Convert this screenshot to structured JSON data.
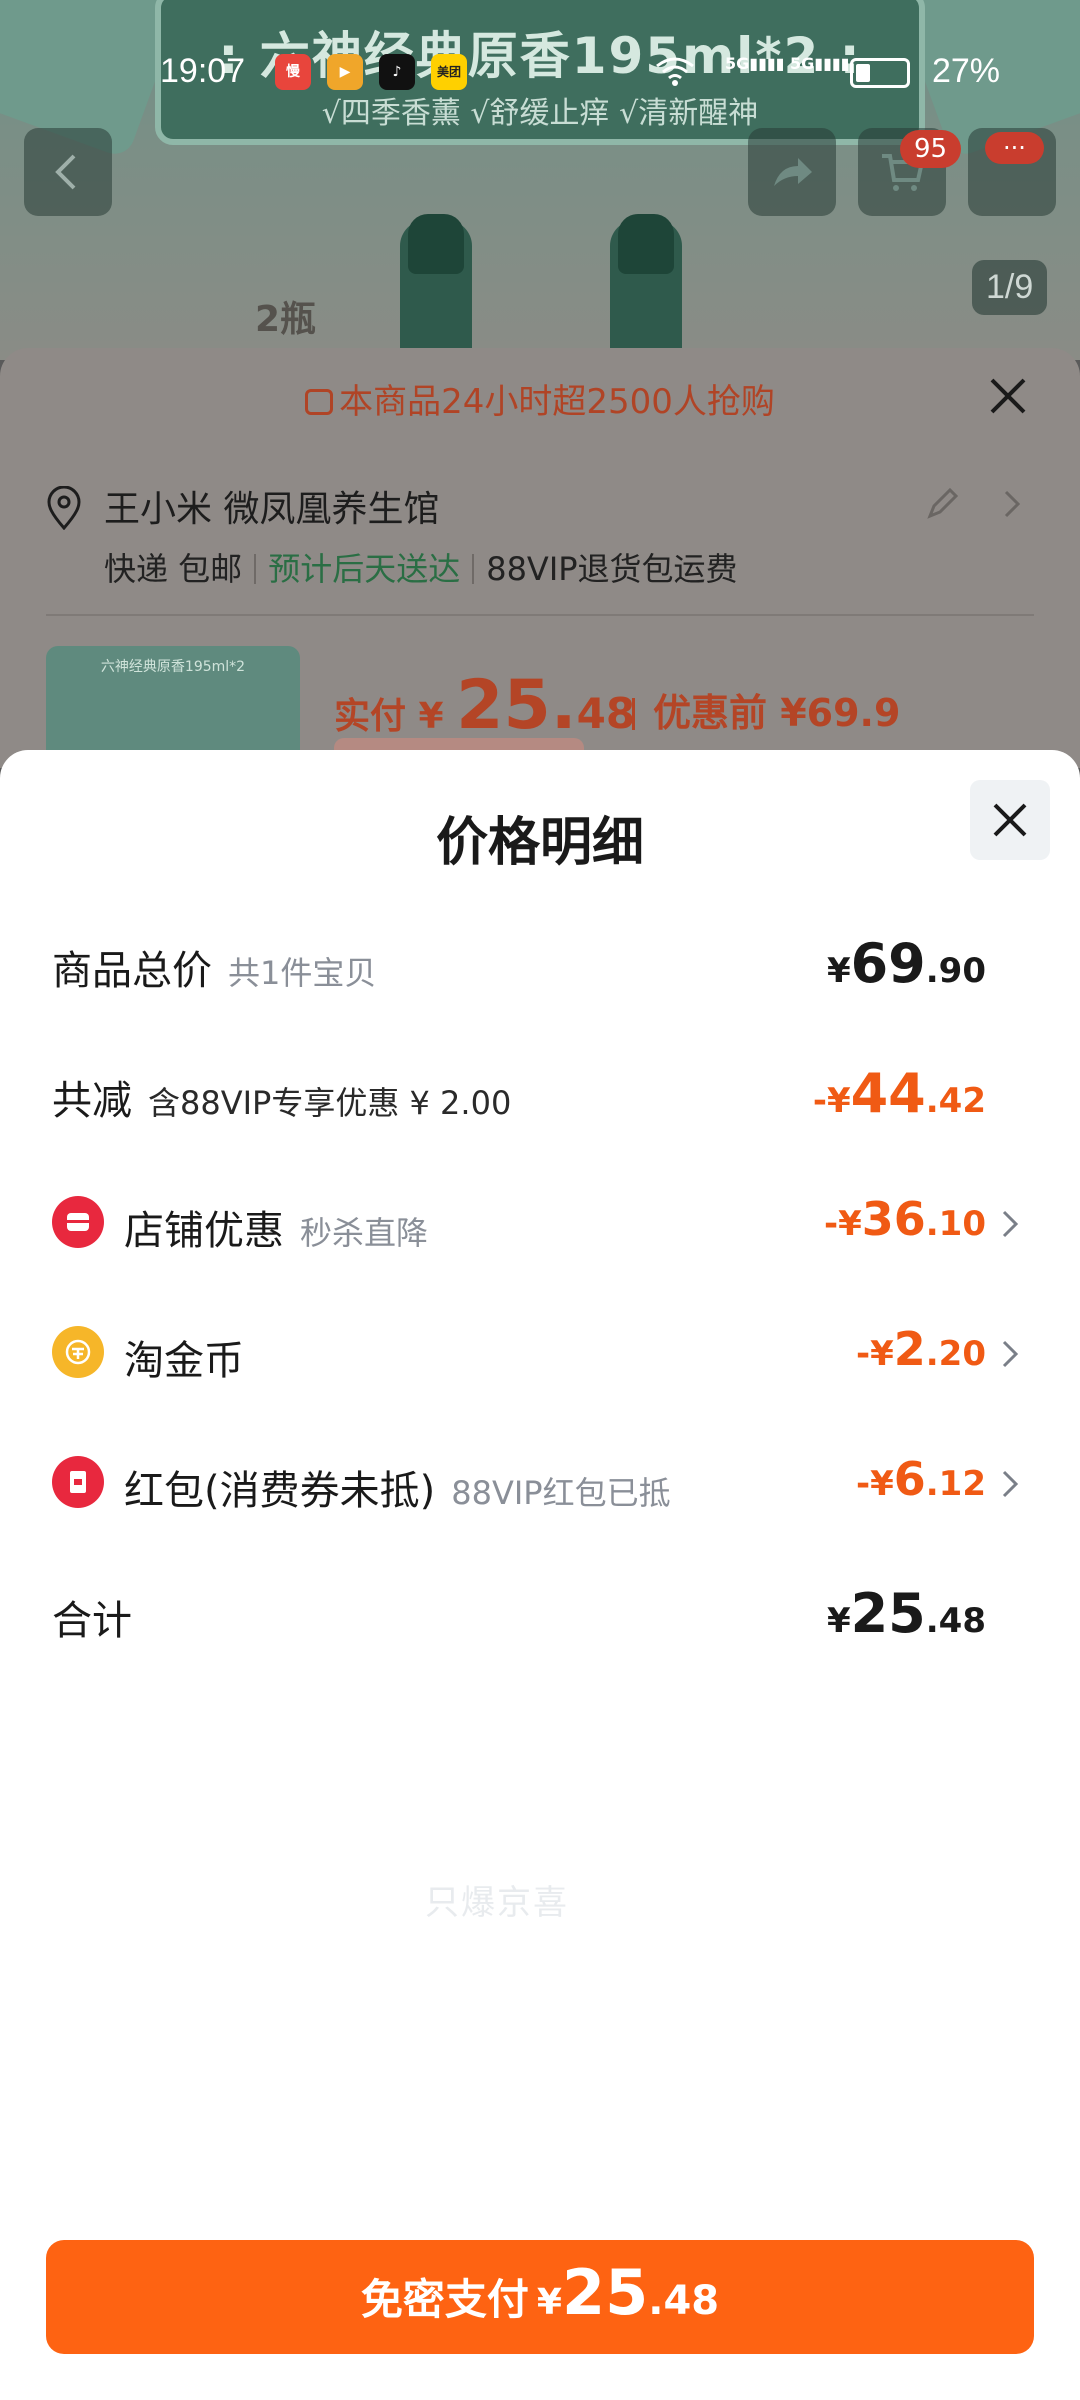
{
  "status_bar": {
    "time": "19:07",
    "battery": "27%",
    "apps": [
      "慢",
      "▶",
      "♪",
      "美团"
    ]
  },
  "background_page": {
    "banner_title": ": 六神经典原香195ml*2 :",
    "banner_sub": "√四季香薰  √舒缓止痒  √清新醒神",
    "image_counter": "1/9",
    "cart_badge": "95",
    "more_badge": "···",
    "two_bottle": "2瓶"
  },
  "order_sheet": {
    "rush_text": "本商品24小时超2500人抢购",
    "address_name": "王小米 微凤凰养生馆",
    "shipping_express": "快递 包邮",
    "shipping_eta": "预计后天送达",
    "shipping_return": "88VIP退货包运费",
    "thumb_title": "六神经典原香195ml*2",
    "paid_label": "实付 ¥ ",
    "paid_int": "25.",
    "paid_dec": "48",
    "before_label": "优惠前 ¥69.9"
  },
  "price_detail": {
    "title": "价格明细",
    "watermark": "只爆京喜",
    "rows": [
      {
        "label": "商品总价",
        "sub": "共1件宝贝",
        "sign": "",
        "sym": "¥",
        "int": "69",
        "dec": ".90"
      },
      {
        "label": "共减",
        "sub": "含88VIP专享优惠 ¥ 2.00",
        "sign": "-",
        "sym": "¥",
        "int": "44",
        "dec": ".42"
      },
      {
        "label": "店铺优惠",
        "sub": "秒杀直降",
        "sign": "-",
        "sym": "¥",
        "int": "36",
        "dec": ".10"
      },
      {
        "label": "淘金币",
        "sub": "",
        "sign": "-",
        "sym": "¥",
        "int": "2",
        "dec": ".20"
      },
      {
        "label": "红包(消费券未抵)",
        "sub": "88VIP红包已抵",
        "sign": "-",
        "sym": "¥",
        "int": "6",
        "dec": ".12"
      },
      {
        "label": "合计",
        "sub": "",
        "sign": "",
        "sym": "¥",
        "int": "25",
        "dec": ".48"
      }
    ]
  },
  "pay_button": {
    "label": "免密支付",
    "sym": "¥",
    "int": "25",
    "dec": ".48"
  },
  "colors": {
    "accent_orange": "#fe6312",
    "discount_orange": "#f05a14",
    "icon_red": "#e8283e",
    "coin_gold": "#f6b629"
  }
}
